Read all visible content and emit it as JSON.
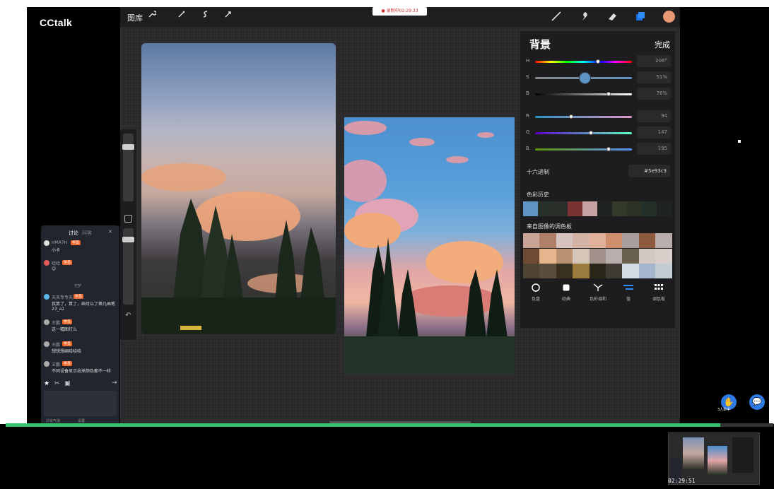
{
  "app": {
    "name": "CCtalk"
  },
  "recording": {
    "label": "● 录制中02:29:33"
  },
  "toolbar": {
    "gallery_label": "图库",
    "tools": [
      "brush",
      "smudge",
      "eraser",
      "layers"
    ],
    "left_icons": [
      "wrench",
      "magic-wand",
      "selection",
      "transform"
    ]
  },
  "color_panel": {
    "title": "背景",
    "done_label": "完成",
    "sliders": [
      {
        "key": "H",
        "value": "208°",
        "level": 0.65
      },
      {
        "key": "S",
        "value": "51%",
        "level": 0.51
      },
      {
        "key": "B",
        "value": "76%",
        "level": 0.76
      },
      {
        "key": "R",
        "value": "94",
        "level": 0.37
      },
      {
        "key": "G",
        "value": "147",
        "level": 0.58
      },
      {
        "key": "B",
        "value": "195",
        "level": 0.76
      }
    ],
    "hex_label": "十六进制",
    "hex_value": "#5e93c3",
    "history_label": "色彩历史",
    "history_colors": [
      "#5e93c3",
      "#28302a",
      "#2b2f2a",
      "#7a3232",
      "#c5a2a2",
      "#1f2421",
      "#343a2a",
      "#2b3327",
      "#223027",
      "#1f2422"
    ],
    "palette_label": "来自图像的调色板",
    "palette_colors": [
      "#c9a496",
      "#b07f6a",
      "#d7c3bd",
      "#d4b3a6",
      "#e2b19b",
      "#cf8e6c",
      "#a99e9b",
      "#8d5a40",
      "#b9aeab",
      "#6c4a33",
      "#e7b58d",
      "#b99274",
      "#d5c6b9",
      "#a2918a",
      "#b8aeab",
      "#69604f",
      "#d1c8c3",
      "#d8cfca",
      "#4f4336",
      "#5a4d3c",
      "#3a3021",
      "#9b7a3e",
      "#2b2718",
      "#3f3a33",
      "#d4dde6",
      "#a4b6cc",
      "#c3cbd3"
    ],
    "modes": [
      "色盘",
      "经典",
      "色彩调和",
      "值",
      "调色板"
    ]
  },
  "chat": {
    "tabs": [
      "讨论",
      "问答"
    ],
    "close": "✕",
    "divider_label": "花梦",
    "messages": [
      {
        "name": "HMA7H",
        "tag": "学员",
        "text": "小卡"
      },
      {
        "name": "哈哈",
        "tag": "学员",
        "text": "😊"
      },
      {
        "name": "天天专专天天",
        "tag": "学员",
        "text": "我算了，算了，画可以了第几画笔 23_a1"
      },
      {
        "name": "王鹏",
        "tag": "学员",
        "text": "这一幅图灯么"
      },
      {
        "name": "王鹏",
        "tag": "学员",
        "text": "想想想画哈哈哈"
      },
      {
        "name": "王鹏",
        "tag": "学员",
        "text": "不同设备显示出来颜色都不一样"
      }
    ],
    "bottom_links": [
      "讨论气泡",
      "设置"
    ],
    "tools": [
      "star",
      "scissors",
      "image"
    ],
    "send": "→"
  },
  "side": {
    "raise_hand_label": "3人举手"
  },
  "video": {
    "progress": 0.93,
    "thumbnail_time": "02:29:51"
  }
}
